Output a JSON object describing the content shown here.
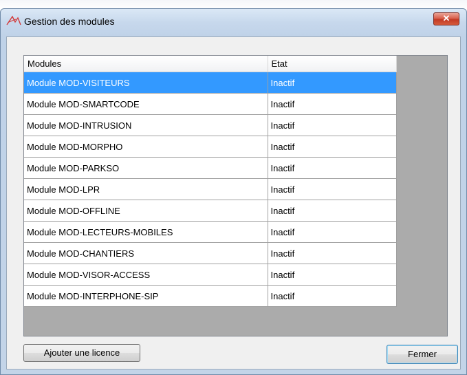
{
  "window": {
    "title": "Gestion des modules",
    "close_label": "✕"
  },
  "grid": {
    "columns": [
      "Modules",
      "Etat"
    ],
    "rows": [
      {
        "module": "Module MOD-VISITEURS",
        "state": "Inactif",
        "selected": true
      },
      {
        "module": "Module MOD-SMARTCODE",
        "state": "Inactif"
      },
      {
        "module": "Module MOD-INTRUSION",
        "state": "Inactif"
      },
      {
        "module": "Module MOD-MORPHO",
        "state": "Inactif"
      },
      {
        "module": "Module MOD-PARKSO",
        "state": "Inactif"
      },
      {
        "module": "Module MOD-LPR",
        "state": "Inactif"
      },
      {
        "module": "Module MOD-OFFLINE",
        "state": "Inactif"
      },
      {
        "module": "Module MOD-LECTEURS-MOBILES",
        "state": "Inactif"
      },
      {
        "module": "Module MOD-CHANTIERS",
        "state": "Inactif"
      },
      {
        "module": "Module MOD-VISOR-ACCESS",
        "state": "Inactif"
      },
      {
        "module": "Module MOD-INTERPHONE-SIP",
        "state": "Inactif"
      }
    ]
  },
  "buttons": {
    "add_license": "Ajouter une licence",
    "close": "Fermer"
  },
  "colors": {
    "selection": "#3399ff",
    "close_button": "#c9432b",
    "title_bar": "#c7d8ec"
  },
  "icons": {
    "app": "app-logo-icon",
    "close": "close-icon"
  }
}
